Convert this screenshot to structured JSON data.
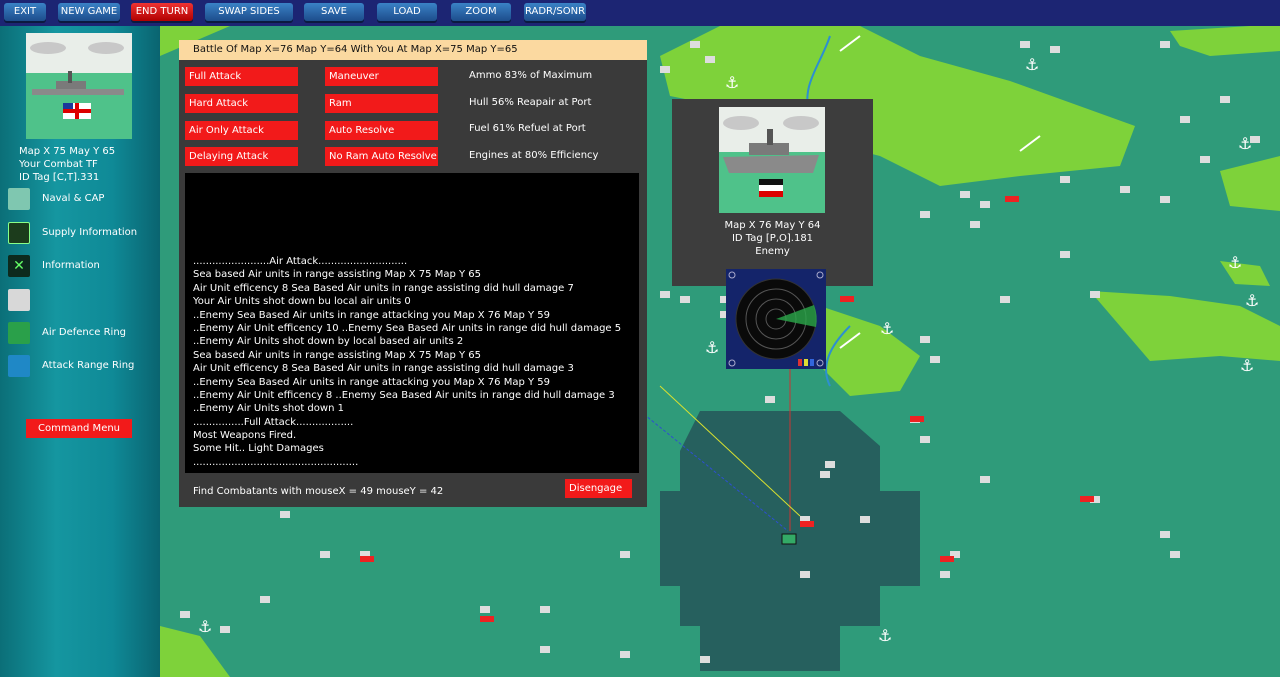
{
  "toolbar": {
    "buttons": [
      {
        "label": "EXIT",
        "color": "blue"
      },
      {
        "label": "NEW GAME",
        "color": "blue"
      },
      {
        "label": "END TURN",
        "color": "red"
      },
      {
        "label": "SWAP SIDES",
        "color": "blue"
      },
      {
        "label": "SAVE",
        "color": "blue"
      },
      {
        "label": "LOAD",
        "color": "blue"
      },
      {
        "label": "ZOOM",
        "color": "blue"
      },
      {
        "label": "RADR/SONR",
        "color": "blue"
      }
    ]
  },
  "sidebar": {
    "info": [
      "Map X 75  May Y 65",
      "Your Combat TF",
      "ID Tag [C,T].331"
    ],
    "items": [
      {
        "label": "Naval & CAP",
        "icon": "naval-cap-icon"
      },
      {
        "label": "Supply Information",
        "icon": "supply-icon"
      },
      {
        "label": "Information",
        "icon": "information-icon"
      },
      {
        "label": "",
        "icon": "blank-icon"
      },
      {
        "label": "Air Defence Ring",
        "icon": "air-defence-ring-icon"
      },
      {
        "label": "Attack Range Ring",
        "icon": "attack-range-ring-icon"
      }
    ],
    "command_menu": "Command Menu"
  },
  "battle": {
    "title": "Battle Of Map X=76  Map Y=64  With You At Map X=75  Map Y=65",
    "actions_left": [
      "Full Attack",
      "Hard Attack",
      "Air Only Attack",
      "Delaying Attack"
    ],
    "actions_right": [
      "Maneuver",
      "Ram",
      "Auto Resolve",
      "No Ram Auto Resolve"
    ],
    "stats": [
      "Ammo 83% of Maximum",
      "Hull 56% Reapair at Port",
      "Fuel 61% Refuel at Port",
      "Engines at 80% Efficiency"
    ],
    "log": [
      "........................Air Attack............................",
      "Sea based Air units in range assisting Map X 75  Map Y 65",
      "Air Unit efficency 8  Sea Based Air units in range assisting did hull damage 7",
      "Your Air Units shot down bu local air units 0",
      "..Enemy Sea Based Air units in range attacking you Map X 76  Map Y 59",
      "..Enemy Air Unit efficency 10 ..Enemy  Sea Based Air units in range did hull damage 5",
      "..Enemy Air Units shot down by local based air units 2",
      "Sea based Air units in range assisting Map X 75  Map Y 65",
      "Air Unit efficency 8  Sea Based Air units in range assisting did hull damage 3",
      "..Enemy Sea Based Air units in range attacking you Map X 76  Map Y 59",
      "..Enemy Air Unit efficency 8 ..Enemy  Sea Based Air units in range did hull damage 3",
      "..Enemy Air Units shot down 1",
      "................Full Attack..................",
      "Most Weapons Fired.",
      "Some Hit.. Light Damages",
      "...................................................."
    ],
    "find_text": "Find Combatants with mouseX = 49 mouseY = 42",
    "disengage": "Disengage"
  },
  "enemy": {
    "info": [
      "Map X 76  May Y 64",
      "ID Tag [P,O].181",
      "Enemy"
    ]
  },
  "colors": {
    "sea": "#2f9b7a",
    "land": "#7ed23a",
    "range_zone": "#26605e",
    "button_red": "#f21a1a",
    "toolbar_bg": "#1c2573",
    "title_bar": "#fbd9a0"
  }
}
